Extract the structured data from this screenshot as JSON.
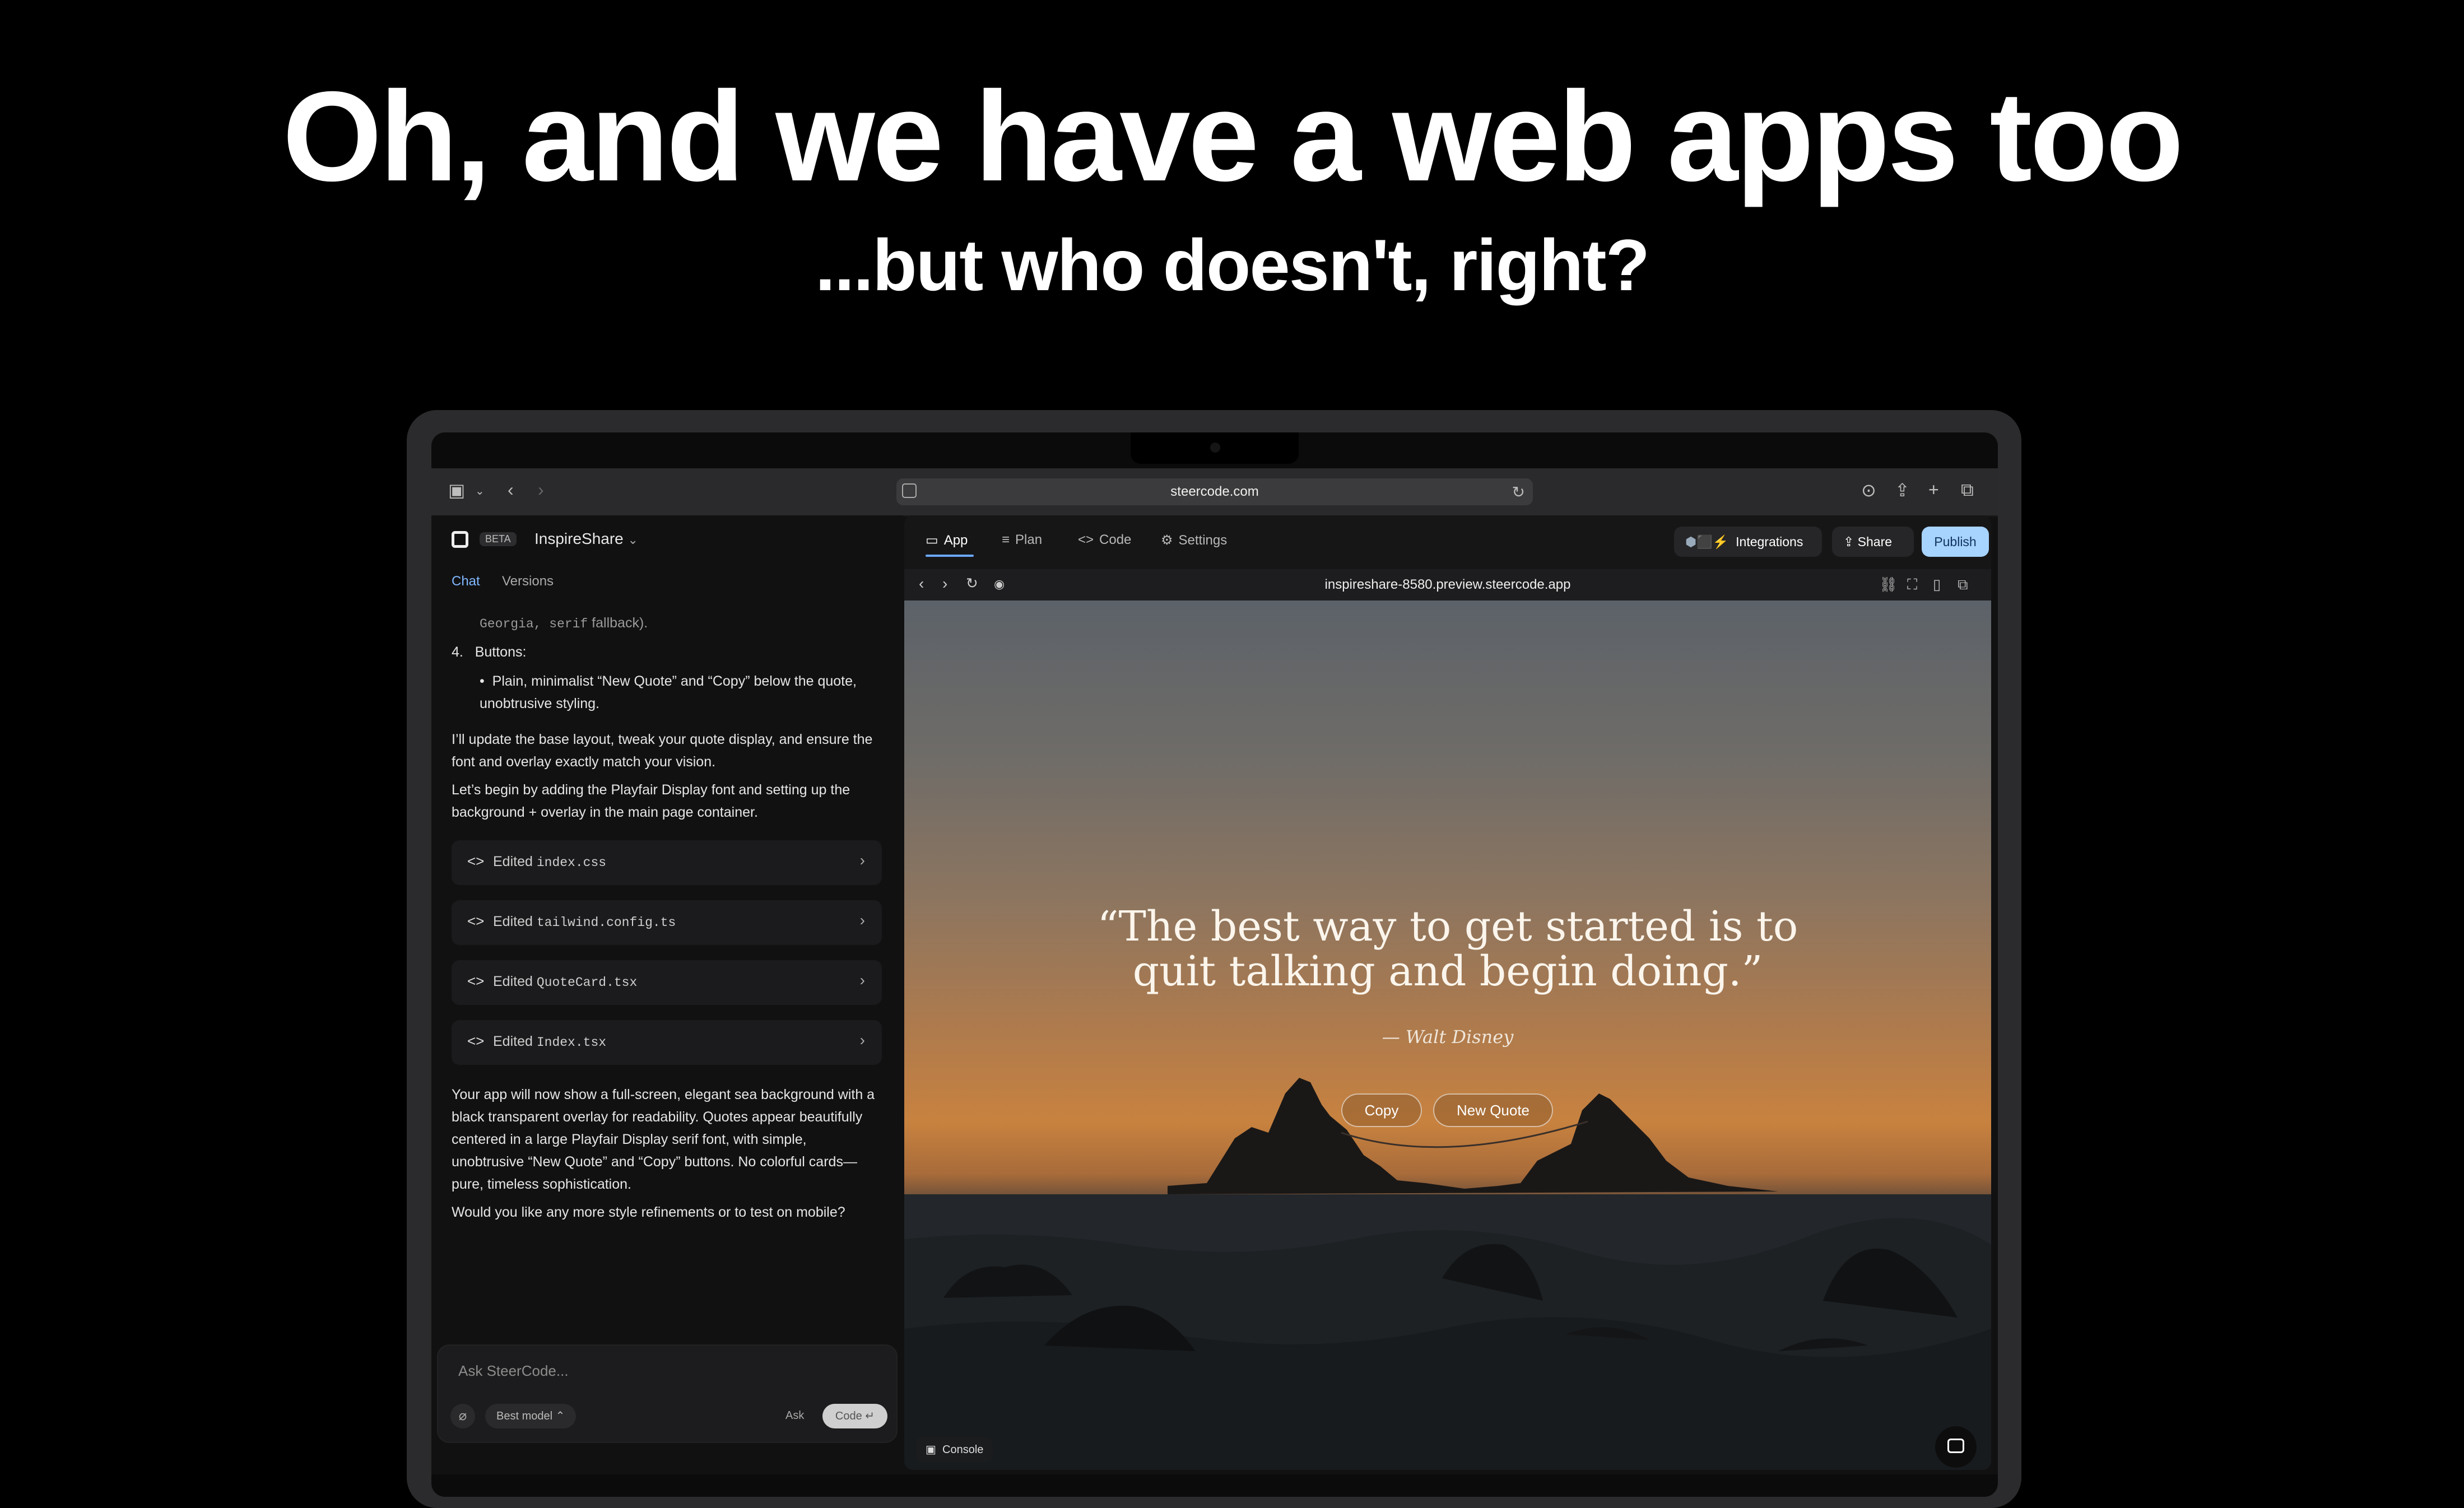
{
  "hero": {
    "headline": "Oh, and we have a web apps too",
    "subheadline": "...but who doesn't, right?"
  },
  "browser": {
    "url": "steercode.com",
    "icons": [
      "sidebar-toggle-icon",
      "chevron-down-icon",
      "back-icon",
      "forward-icon",
      "site-icon",
      "reload-icon",
      "download-icon",
      "share-icon",
      "new-tab-icon",
      "tabs-overview-icon"
    ]
  },
  "app": {
    "badge": "BETA",
    "project_name": "InspireShare",
    "tabs": [
      "Chat",
      "Versions"
    ],
    "active_tab": "Chat"
  },
  "chat": {
    "fragment_code": "Georgia, serif",
    "fragment_tail": " fallback).",
    "list_number": "4.",
    "list_title": "Buttons:",
    "bullet": "Plain, minimalist “New Quote” and “Copy” below the quote, unobtrusive styling.",
    "para1": "I’ll update the base layout, tweak your quote display, and ensure the font and overlay exactly match your vision.",
    "para2": "Let’s begin by adding the Playfair Display font and setting up the background + overlay in the main page container.",
    "edited_label": "Edited",
    "edits": [
      "index.css",
      "tailwind.config.ts",
      "QuoteCard.tsx",
      "Index.tsx"
    ],
    "para3": "Your app will now show a full-screen, elegant sea background with a black transparent overlay for readability. Quotes appear beautifully centered in a large Playfair Display serif font, with simple, unobtrusive “New Quote” and “Copy” buttons. No colorful cards—pure, timeless sophistication.",
    "para4": "Would you like any more style refinements or to test on mobile?"
  },
  "composer": {
    "placeholder": "Ask SteerCode...",
    "model": "Best model",
    "ask": "Ask",
    "code": "Code"
  },
  "preview": {
    "tabs": [
      {
        "label": "App",
        "icon": "monitor-icon"
      },
      {
        "label": "Plan",
        "icon": "list-icon"
      },
      {
        "label": "Code",
        "icon": "code-icon"
      },
      {
        "label": "Settings",
        "icon": "gear-icon"
      }
    ],
    "integrations": "Integrations",
    "share": "Share",
    "publish": "Publish",
    "preview_url": "inspireshare-8580.preview.steercode.app",
    "quote_line1": "“The best way to get started is to",
    "quote_line2": "quit talking and begin doing.”",
    "author": "— Walt Disney",
    "copy_button": "Copy",
    "new_quote_button": "New Quote",
    "console": "Console"
  },
  "colors": {
    "background": "#000000",
    "accent": "#6aa8ff",
    "publish": "#a7d3ff"
  }
}
